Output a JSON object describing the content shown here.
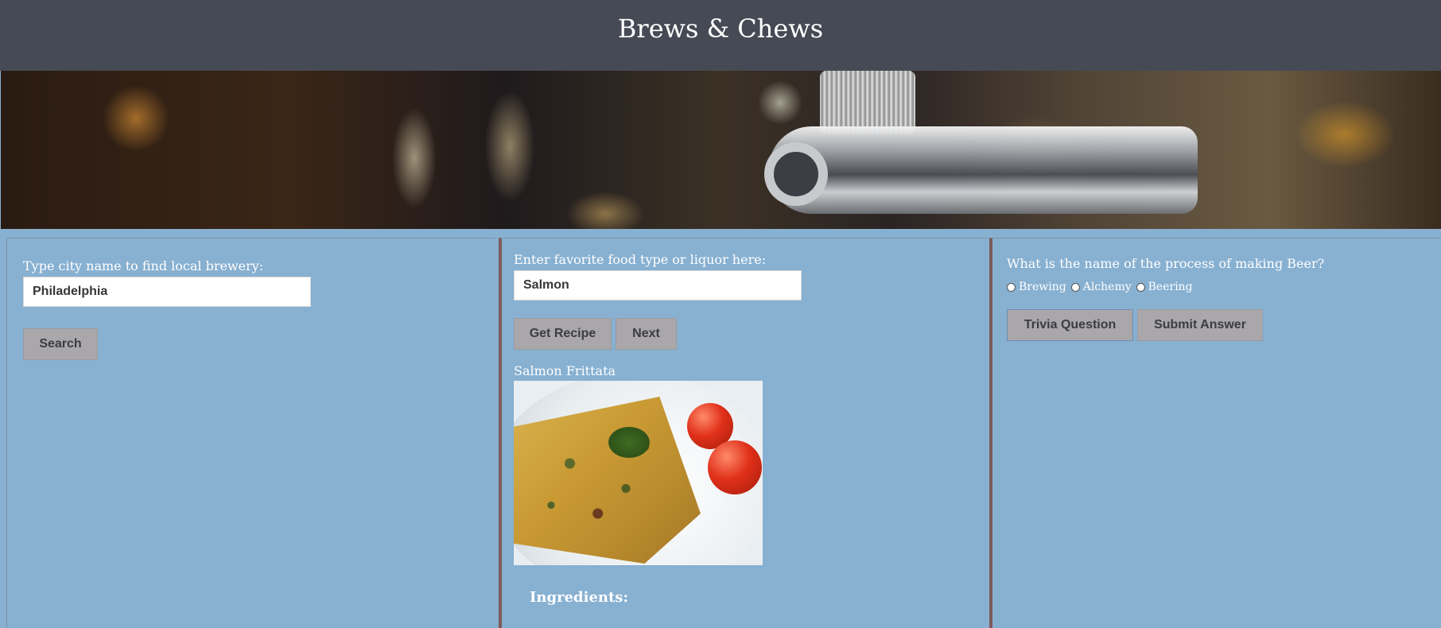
{
  "header": {
    "title": "Brews & Chews"
  },
  "brewery": {
    "label": "Type city name to find local brewery:",
    "input_value": "Philadelphia",
    "search_label": "Search"
  },
  "recipe": {
    "label": "Enter favorite food type or liquor here:",
    "input_value": "Salmon",
    "get_recipe_label": "Get Recipe",
    "next_label": "Next",
    "recipe_title": "Salmon Frittata",
    "ingredients_heading": "Ingredients:"
  },
  "trivia": {
    "question": "What is the name of the process of making Beer?",
    "options": [
      "Brewing",
      "Alchemy",
      "Beering"
    ],
    "trivia_button_label": "Trivia Question",
    "submit_button_label": "Submit Answer"
  }
}
